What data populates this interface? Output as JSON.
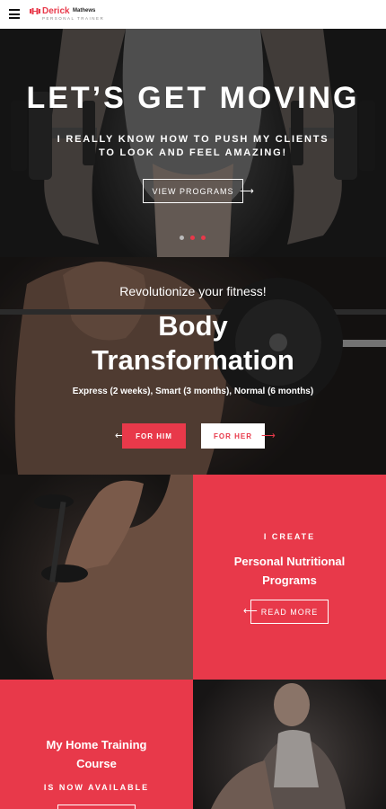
{
  "brand": {
    "first_name": "Derick",
    "last_name": "Mathews",
    "tagline": "PERSONAL TRAINER",
    "accent_color": "#e8394a"
  },
  "header": {
    "menu_icon": "hamburger-menu-icon",
    "logo_icon": "dumbbell-icon"
  },
  "hero": {
    "title": "LET’S GET MOVING",
    "subtitle_line1": "I REALLY KNOW HOW TO PUSH MY CLIENTS",
    "subtitle_line2": "TO LOOK AND FEEL AMAZING!",
    "button_label": "VIEW PROGRAMS",
    "slides": 3,
    "active_slide": 2
  },
  "transformation": {
    "kicker": "Revolutionize your fitness!",
    "title_line1": "Body",
    "title_line2": "Transformation",
    "description": "Express (2 weeks), Smart (3 months), Normal (6 months)",
    "button_him": "FOR HIM",
    "button_her": "FOR HER"
  },
  "nutrition": {
    "kicker": "I CREATE",
    "title_line1": "Personal Nutritional",
    "title_line2": "Programs",
    "button_label": "READ MORE"
  },
  "home_training": {
    "title_line1": "My Home Training",
    "title_line2": "Course",
    "kicker": "IS NOW AVAILABLE"
  }
}
